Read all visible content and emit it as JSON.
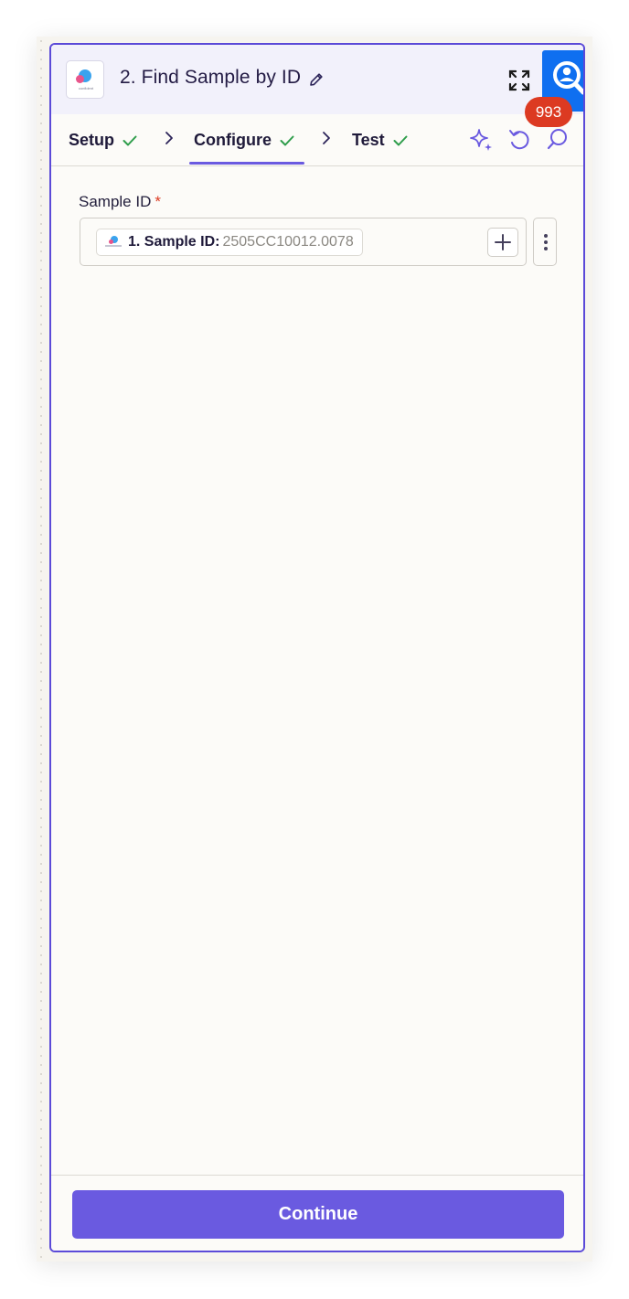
{
  "header": {
    "app_logo_text": "confident",
    "step_title": "2. Find Sample by ID",
    "notification_count": "993"
  },
  "tabs": [
    {
      "label": "Setup",
      "status": "complete"
    },
    {
      "label": "Configure",
      "status": "complete",
      "active": true
    },
    {
      "label": "Test",
      "status": "complete"
    }
  ],
  "form": {
    "field_label": "Sample ID",
    "required_marker": "*",
    "mapped_value": {
      "label": "1. Sample ID:",
      "value": "2505CC10012.0078"
    }
  },
  "footer": {
    "continue_label": "Continue"
  },
  "colors": {
    "accent": "#6a5ae0",
    "panel_border": "#5b4ad8",
    "check_green": "#2e9d4b",
    "badge_red": "#dc3a22",
    "fab_blue": "#0f6ff0"
  },
  "icons": [
    "pencil-icon",
    "expand-icon",
    "search-person-icon",
    "check-icon",
    "chevron-right-icon",
    "sparkle-icon",
    "undo-icon",
    "comment-search-icon",
    "plus-icon",
    "kebab-icon"
  ]
}
